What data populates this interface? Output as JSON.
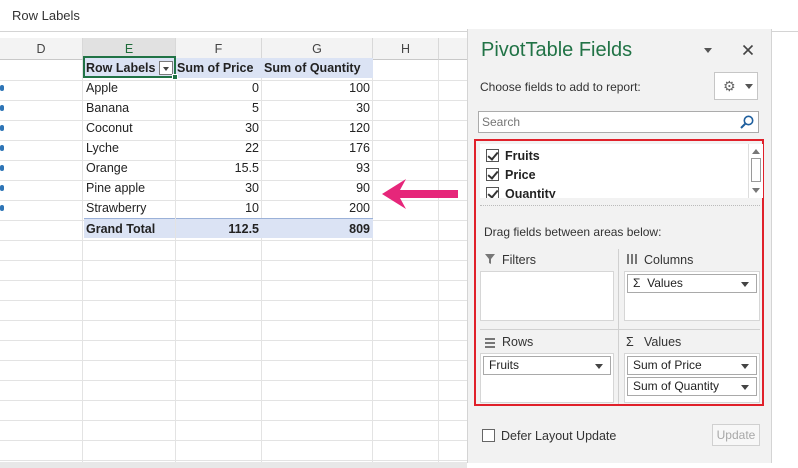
{
  "formula_bar": {
    "name_box": "Row Labels"
  },
  "grid": {
    "columns": [
      "D",
      "E",
      "F",
      "G",
      "H"
    ],
    "selected_column": "E"
  },
  "pivot_table": {
    "header": {
      "row_labels": "Row Labels",
      "price": "Sum of  Price",
      "quantity": "Sum of  Quantity"
    },
    "rows": [
      {
        "label": "Apple",
        "price": "0",
        "quantity": "100"
      },
      {
        "label": "Banana",
        "price": "5",
        "quantity": "30"
      },
      {
        "label": "Coconut",
        "price": "30",
        "quantity": "120"
      },
      {
        "label": "Lyche",
        "price": "22",
        "quantity": "176"
      },
      {
        "label": "Orange",
        "price": "15.5",
        "quantity": "93"
      },
      {
        "label": "Pine apple",
        "price": "30",
        "quantity": "90"
      },
      {
        "label": "Strawberry",
        "price": "10",
        "quantity": "200"
      }
    ],
    "total": {
      "label": "Grand Total",
      "price": "112.5",
      "quantity": "809"
    }
  },
  "annotation": {
    "arrow_color": "#e6267a"
  },
  "pane": {
    "title": "PivotTable Fields",
    "choose_label": "Choose fields to add to report:",
    "search_placeholder": "Search",
    "fields": [
      {
        "label": "Fruits",
        "checked": true
      },
      {
        "label": "Price",
        "checked": true
      },
      {
        "label": "Quantity",
        "checked": true
      }
    ],
    "drag_label": "Drag fields between areas below:",
    "filters": {
      "title": "Filters"
    },
    "columns": {
      "title": "Columns",
      "items": [
        "Values"
      ]
    },
    "rows": {
      "title": "Rows",
      "items": [
        "Fruits"
      ]
    },
    "values": {
      "title": "Values",
      "items": [
        "Sum of  Price",
        "Sum of  Quantity"
      ]
    },
    "defer_label": "Defer Layout Update",
    "update_label": "Update",
    "accent_color": "#217346",
    "highlight_color": "#e0202a"
  }
}
